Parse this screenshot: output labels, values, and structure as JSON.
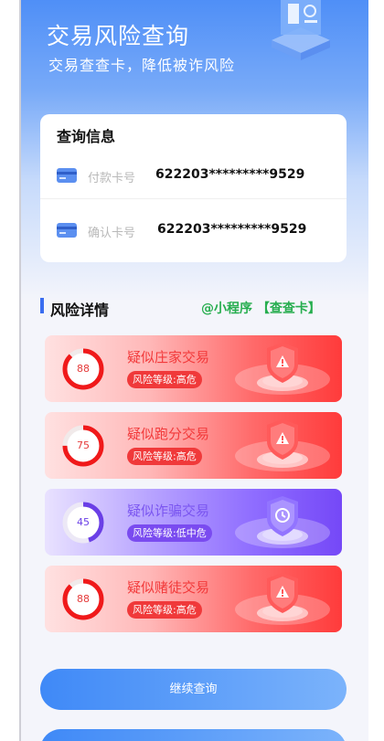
{
  "header": {
    "title": "交易风险查询",
    "subtitle": "交易查查卡，降低被诈风险"
  },
  "query_info": {
    "title": "查询信息",
    "rows": [
      {
        "label": "付款卡号",
        "value": "622203*********9529",
        "icon": "bank-card-icon"
      },
      {
        "label": "确认卡号",
        "value": "622203*********9529",
        "icon": "bank-card-icon"
      }
    ]
  },
  "risk_section": {
    "title": "风险详情",
    "promo": "@小程序 【查查卡】",
    "accent": "#3a6df0"
  },
  "risks": [
    {
      "score": "88",
      "level": 0.88,
      "title": "疑似庄家交易",
      "badge": "风险等级:高危",
      "color": "#f0393a",
      "icon": "warning-shield-icon"
    },
    {
      "score": "75",
      "level": 0.75,
      "title": "疑似跑分交易",
      "badge": "风险等级:高危",
      "color": "#f0393a",
      "icon": "warning-shield-icon"
    },
    {
      "score": "45",
      "level": 0.45,
      "title": "疑似诈骗交易",
      "badge": "风险等级:低中危",
      "color": "#7a4bf0",
      "icon": "clock-shield-icon"
    },
    {
      "score": "88",
      "level": 0.88,
      "title": "疑似赌徒交易",
      "badge": "风险等级:高危",
      "color": "#f0393a",
      "icon": "warning-shield-icon"
    }
  ],
  "actions": {
    "continue_label": "继续查询"
  }
}
